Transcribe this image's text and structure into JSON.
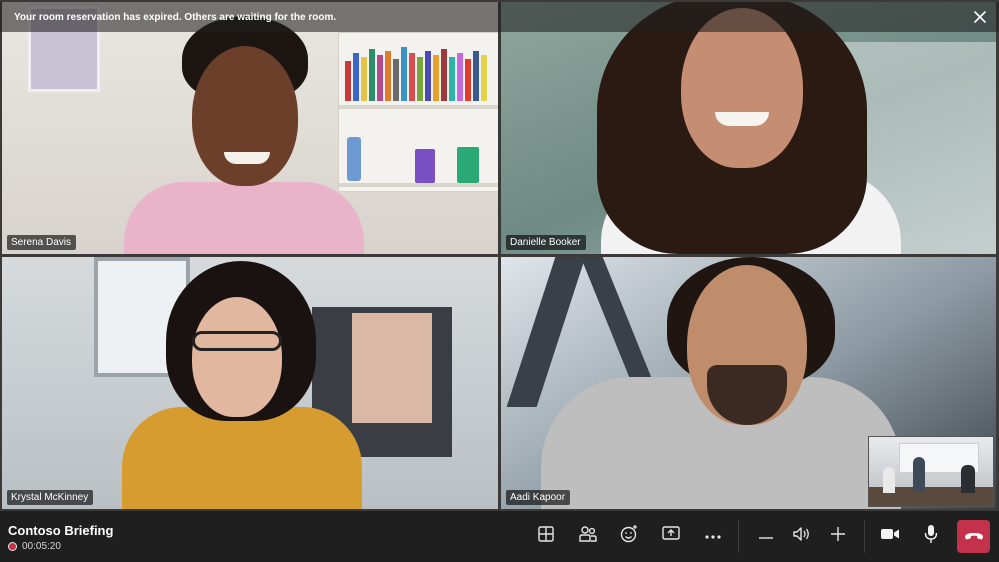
{
  "banner": {
    "message": "Your room reservation has expired. Others are waiting for the room.",
    "close_icon": "close-icon"
  },
  "participants": [
    {
      "name": "Serena Davis"
    },
    {
      "name": "Danielle Booker"
    },
    {
      "name": "Krystal McKinney"
    },
    {
      "name": "Aadi Kapoor"
    }
  ],
  "meeting": {
    "title": "Contoso Briefing",
    "elapsed": "00:05:20"
  },
  "controls": {
    "icons": [
      "layout-grid-icon",
      "participants-icon",
      "reactions-icon",
      "share-screen-icon",
      "more-options-icon",
      "volume-down-icon",
      "speaker-icon",
      "volume-up-icon",
      "camera-icon",
      "microphone-icon",
      "hang-up-icon"
    ]
  },
  "colors": {
    "hangup": "#c4314b",
    "recording": "#c4314b",
    "bar_background": "#1f1f1f"
  }
}
